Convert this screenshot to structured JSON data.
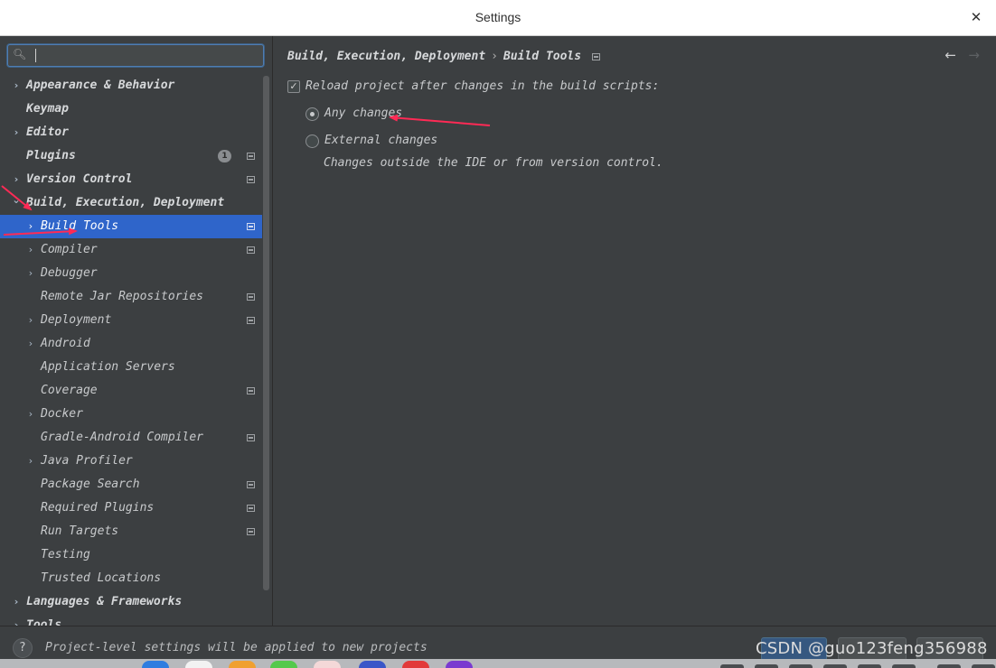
{
  "window": {
    "title": "Settings",
    "close_glyph": "✕"
  },
  "search": {
    "icon": "search-icon",
    "value": ""
  },
  "sidebar": {
    "items": [
      {
        "label": "Appearance & Behavior",
        "level": 0,
        "expand": "collapsed",
        "bold": true
      },
      {
        "label": "Keymap",
        "level": 0,
        "expand": "none",
        "bold": true
      },
      {
        "label": "Editor",
        "level": 0,
        "expand": "collapsed",
        "bold": true
      },
      {
        "label": "Plugins",
        "level": 0,
        "expand": "none",
        "bold": true,
        "badge": "1",
        "project_icon": true
      },
      {
        "label": "Version Control",
        "level": 0,
        "expand": "collapsed",
        "bold": true,
        "project_icon": true
      },
      {
        "label": "Build, Execution, Deployment",
        "level": 0,
        "expand": "expanded",
        "bold": true
      },
      {
        "label": "Build Tools",
        "level": 1,
        "expand": "collapsed",
        "selected": true,
        "project_icon": true
      },
      {
        "label": "Compiler",
        "level": 1,
        "expand": "collapsed",
        "project_icon": true
      },
      {
        "label": "Debugger",
        "level": 1,
        "expand": "collapsed"
      },
      {
        "label": "Remote Jar Repositories",
        "level": 1,
        "expand": "none",
        "project_icon": true
      },
      {
        "label": "Deployment",
        "level": 1,
        "expand": "collapsed",
        "project_icon": true
      },
      {
        "label": "Android",
        "level": 1,
        "expand": "collapsed"
      },
      {
        "label": "Application Servers",
        "level": 1,
        "expand": "none"
      },
      {
        "label": "Coverage",
        "level": 1,
        "expand": "none",
        "project_icon": true
      },
      {
        "label": "Docker",
        "level": 1,
        "expand": "collapsed"
      },
      {
        "label": "Gradle-Android Compiler",
        "level": 1,
        "expand": "none",
        "project_icon": true
      },
      {
        "label": "Java Profiler",
        "level": 1,
        "expand": "collapsed"
      },
      {
        "label": "Package Search",
        "level": 1,
        "expand": "none",
        "project_icon": true
      },
      {
        "label": "Required Plugins",
        "level": 1,
        "expand": "none",
        "project_icon": true
      },
      {
        "label": "Run Targets",
        "level": 1,
        "expand": "none",
        "project_icon": true
      },
      {
        "label": "Testing",
        "level": 1,
        "expand": "none"
      },
      {
        "label": "Trusted Locations",
        "level": 1,
        "expand": "none"
      },
      {
        "label": "Languages & Frameworks",
        "level": 0,
        "expand": "collapsed",
        "bold": true
      },
      {
        "label": "Tools",
        "level": 0,
        "expand": "collapsed",
        "bold": true
      }
    ]
  },
  "content": {
    "breadcrumb": {
      "parent": "Build, Execution, Deployment",
      "separator": "›",
      "current": "Build Tools"
    },
    "nav": {
      "back": "←",
      "forward": "→"
    },
    "reload_checkbox": {
      "label": "Reload project after changes in the build scripts:",
      "checked": true
    },
    "radio_any": {
      "label": "Any changes",
      "selected": true
    },
    "radio_external": {
      "label": "External changes",
      "selected": false
    },
    "external_hint": "Changes outside the IDE or from version control."
  },
  "footer": {
    "help": "?",
    "note": "Project-level settings will be applied to new projects",
    "watermark": "CSDN @guo123feng356988"
  },
  "colors": {
    "background": "#3c3f41",
    "selection": "#2f65ca",
    "annotation_arrow": "#ff2a55",
    "primary_button": "#365880"
  }
}
